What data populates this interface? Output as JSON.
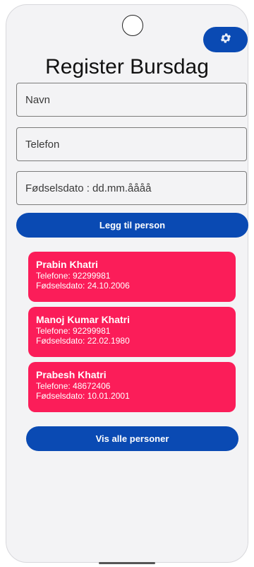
{
  "header": {
    "title": "Register Bursdag",
    "settings_icon": "gear-icon"
  },
  "form": {
    "name_placeholder": "Navn",
    "phone_placeholder": "Telefon",
    "dob_placeholder": "Fødselsdato : dd.mm.åååå",
    "add_button_label": "Legg til person"
  },
  "persons": [
    {
      "name": "Prabin Khatri",
      "phone": "Telefone: 92299981",
      "dob": "Fødselsdato: 24.10.2006"
    },
    {
      "name": "Manoj Kumar Khatri",
      "phone": "Telefone: 92299981",
      "dob": "Fødselsdato: 22.02.1980"
    },
    {
      "name": "Prabesh Khatri",
      "phone": "Telefone: 48672406",
      "dob": "Fødselsdato: 10.01.2001"
    }
  ],
  "footer": {
    "show_all_label": "Vis alle personer"
  },
  "colors": {
    "primary": "#0a4ab3",
    "card": "#fb1d59",
    "background": "#f3f3f5"
  }
}
